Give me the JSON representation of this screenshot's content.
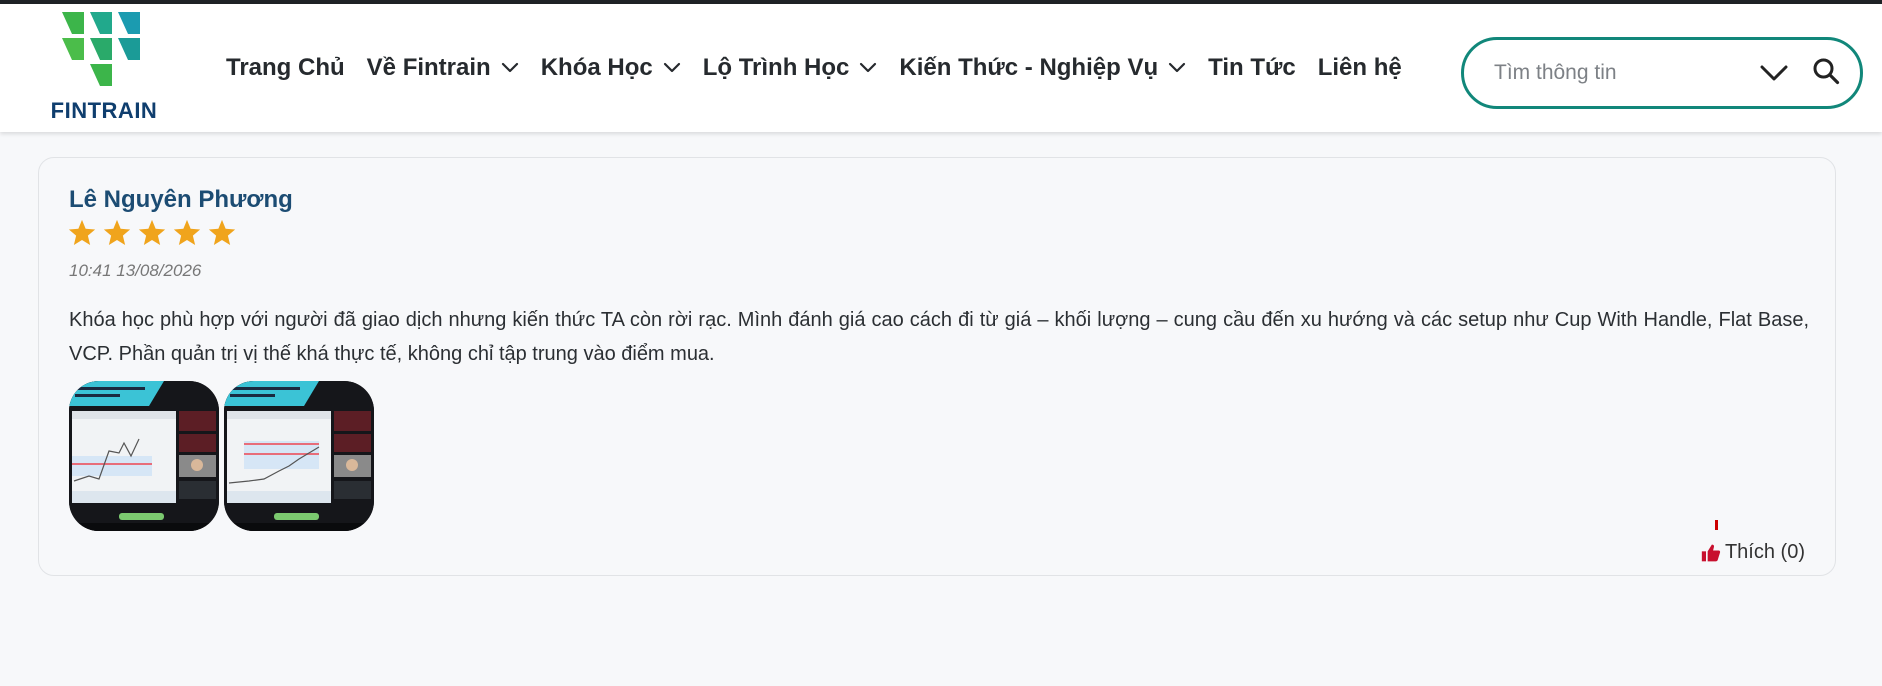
{
  "brand": {
    "name": "FINTRAIN",
    "colors": {
      "green": "#3cb54a",
      "teal": "#1b9b97",
      "navy": "#0f3e6e"
    }
  },
  "nav": {
    "items": [
      {
        "label": "Trang Chủ",
        "has_dropdown": false
      },
      {
        "label": "Về Fintrain",
        "has_dropdown": true
      },
      {
        "label": "Khóa Học",
        "has_dropdown": true
      },
      {
        "label": "Lộ Trình Học",
        "has_dropdown": true
      },
      {
        "label": "Kiến Thức - Nghiệp Vụ",
        "has_dropdown": true
      },
      {
        "label": "Tin Tức",
        "has_dropdown": false
      },
      {
        "label": "Liên hệ",
        "has_dropdown": false
      }
    ]
  },
  "search": {
    "placeholder": "Tìm thông tin",
    "value": "",
    "accent": "#11877a",
    "icons": [
      "chevron-down-icon",
      "search-icon"
    ]
  },
  "review": {
    "author": "Lê Nguyên Phương",
    "rating": 5,
    "rating_max": 5,
    "star_color": "#f0a41c",
    "timestamp": "10:41 13/08/2026",
    "comment": "Khóa học phù hợp với người đã giao dịch nhưng kiến thức TA còn rời rạc. Mình đánh giá cao cách đi từ giá – khối lượng – cung cầu đến xu hướng và các setup như Cup With Handle, Flat Base, VCP. Phần quản trị vị thế khá thực tế, không chỉ tập trung vào điểm mua.",
    "like_label": "Thích (0)",
    "like_icon": "thumbs-up-icon",
    "like_color": "#c8102e"
  }
}
